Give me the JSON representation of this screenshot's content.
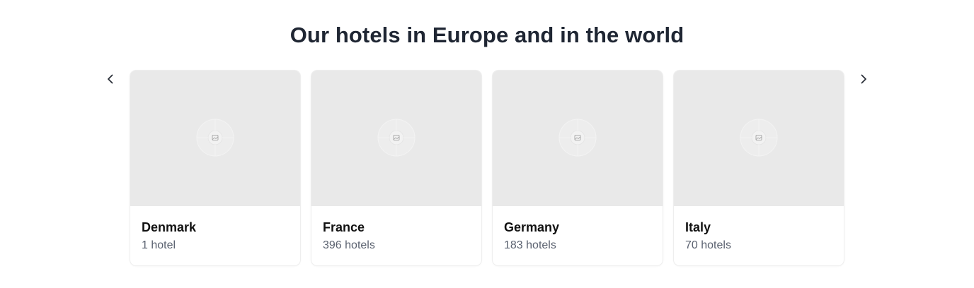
{
  "section": {
    "title": "Our hotels in Europe and in the world"
  },
  "carousel": {
    "prev_icon": "chevron-left-icon",
    "next_icon": "chevron-right-icon",
    "cards": [
      {
        "name": "Denmark",
        "count": "1 hotel"
      },
      {
        "name": "France",
        "count": "396 hotels"
      },
      {
        "name": "Germany",
        "count": "183 hotels"
      },
      {
        "name": "Italy",
        "count": "70 hotels"
      }
    ]
  },
  "colors": {
    "title": "#1f2633",
    "card_image_bg": "#e9e9e9",
    "secondary_text": "#5b6270"
  }
}
